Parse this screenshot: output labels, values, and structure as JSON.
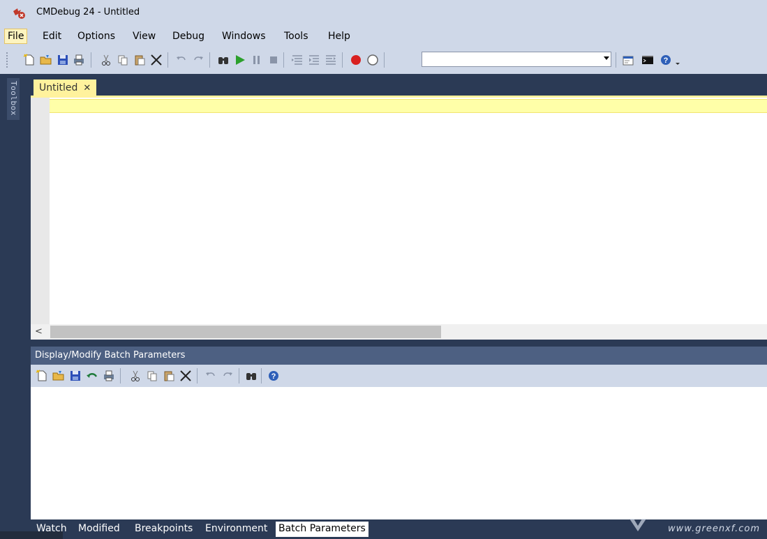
{
  "window": {
    "title": "CMDebug 24 - Untitled"
  },
  "menu": [
    "File",
    "Edit",
    "Options",
    "View",
    "Debug",
    "Windows",
    "Tools",
    "Help"
  ],
  "toolbox": {
    "label": "Toolbox"
  },
  "document": {
    "tab_label": "Untitled",
    "close_glyph": "✕"
  },
  "editor": {
    "scroll_left_glyph": "<"
  },
  "panel": {
    "title": "Display/Modify Batch Parameters"
  },
  "bottom_tabs": [
    "Watch",
    "Modified",
    "Breakpoints",
    "Environment",
    "Batch Parameters"
  ],
  "active_bottom_tab": "Batch Parameters",
  "watermark": "www.greenxf.com",
  "icons": {
    "toolbar": [
      "new-file-icon",
      "open-folder-icon",
      "save-icon",
      "print-icon",
      "cut-icon",
      "copy-icon",
      "paste-icon",
      "delete-icon",
      "undo-icon",
      "redo-icon",
      "find-icon",
      "run-icon",
      "pause-icon",
      "stop-icon",
      "step-into-icon",
      "step-over-icon",
      "step-out-icon",
      "breakpoint-icon",
      "clear-breakpoint-icon",
      "properties-icon",
      "console-icon",
      "help-icon"
    ],
    "panel_toolbar": [
      "new-file-icon",
      "open-folder-icon",
      "save-icon",
      "revert-icon",
      "print-icon",
      "cut-icon",
      "copy-icon",
      "paste-icon",
      "delete-icon",
      "undo-icon",
      "redo-icon",
      "find-icon",
      "help-icon"
    ]
  },
  "colors": {
    "accent_yellow": "#fff29d",
    "panel_header": "#4d6082",
    "chrome": "#cfd8e8",
    "dark_bg": "#2b3a55"
  }
}
